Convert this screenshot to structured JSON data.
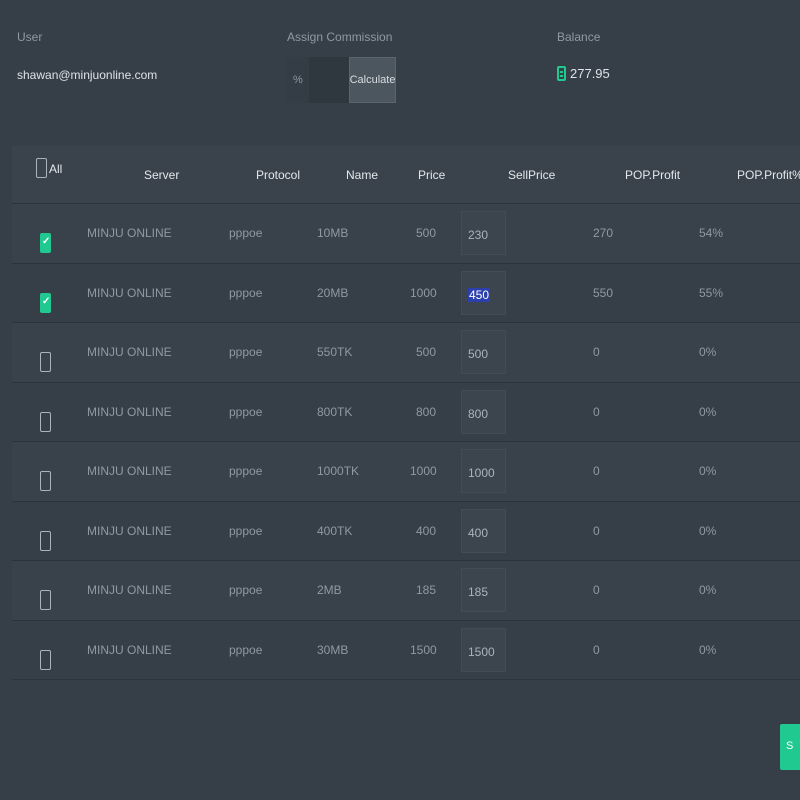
{
  "header": {
    "user_label": "User",
    "user_value": "shawan@minjuonline.com",
    "commission_label": "Assign Commission",
    "commission_unit": "%",
    "commission_value": "",
    "calculate_label": "Calculate",
    "balance_label": "Balance",
    "balance_value": "277.95",
    "balance_icon": "wallet-icon"
  },
  "table": {
    "columns": [
      "All",
      "Server",
      "Protocol",
      "Name",
      "Price",
      "SellPrice",
      "POP.Profit",
      "POP.Profit%"
    ],
    "rows": [
      {
        "checked": true,
        "server": "MINJU ONLINE",
        "protocol": "pppoe",
        "name": "10MB",
        "price": "500",
        "sell_price": "230",
        "profit": "270",
        "profit_pct": "54%"
      },
      {
        "checked": true,
        "server": "MINJU ONLINE",
        "protocol": "pppoe",
        "name": "20MB",
        "price": "1000",
        "sell_price": "450",
        "profit": "550",
        "profit_pct": "55%",
        "focused": true
      },
      {
        "checked": false,
        "server": "MINJU ONLINE",
        "protocol": "pppoe",
        "name": "550TK",
        "price": "500",
        "sell_price": "500",
        "profit": "0",
        "profit_pct": "0%"
      },
      {
        "checked": false,
        "server": "MINJU ONLINE",
        "protocol": "pppoe",
        "name": "800TK",
        "price": "800",
        "sell_price": "800",
        "profit": "0",
        "profit_pct": "0%"
      },
      {
        "checked": false,
        "server": "MINJU ONLINE",
        "protocol": "pppoe",
        "name": "1000TK",
        "price": "1000",
        "sell_price": "1000",
        "profit": "0",
        "profit_pct": "0%"
      },
      {
        "checked": false,
        "server": "MINJU ONLINE",
        "protocol": "pppoe",
        "name": "400TK",
        "price": "400",
        "sell_price": "400",
        "profit": "0",
        "profit_pct": "0%"
      },
      {
        "checked": false,
        "server": "MINJU ONLINE",
        "protocol": "pppoe",
        "name": "2MB",
        "price": "185",
        "sell_price": "185",
        "profit": "0",
        "profit_pct": "0%"
      },
      {
        "checked": false,
        "server": "MINJU ONLINE",
        "protocol": "pppoe",
        "name": "30MB",
        "price": "1500",
        "sell_price": "1500",
        "profit": "0",
        "profit_pct": "0%"
      }
    ]
  },
  "footer": {
    "save_label": "S",
    "save_icon": "save-icon"
  },
  "colors": {
    "background": "#363f48",
    "accent": "#1fc990",
    "selection": "#2b3fae"
  }
}
